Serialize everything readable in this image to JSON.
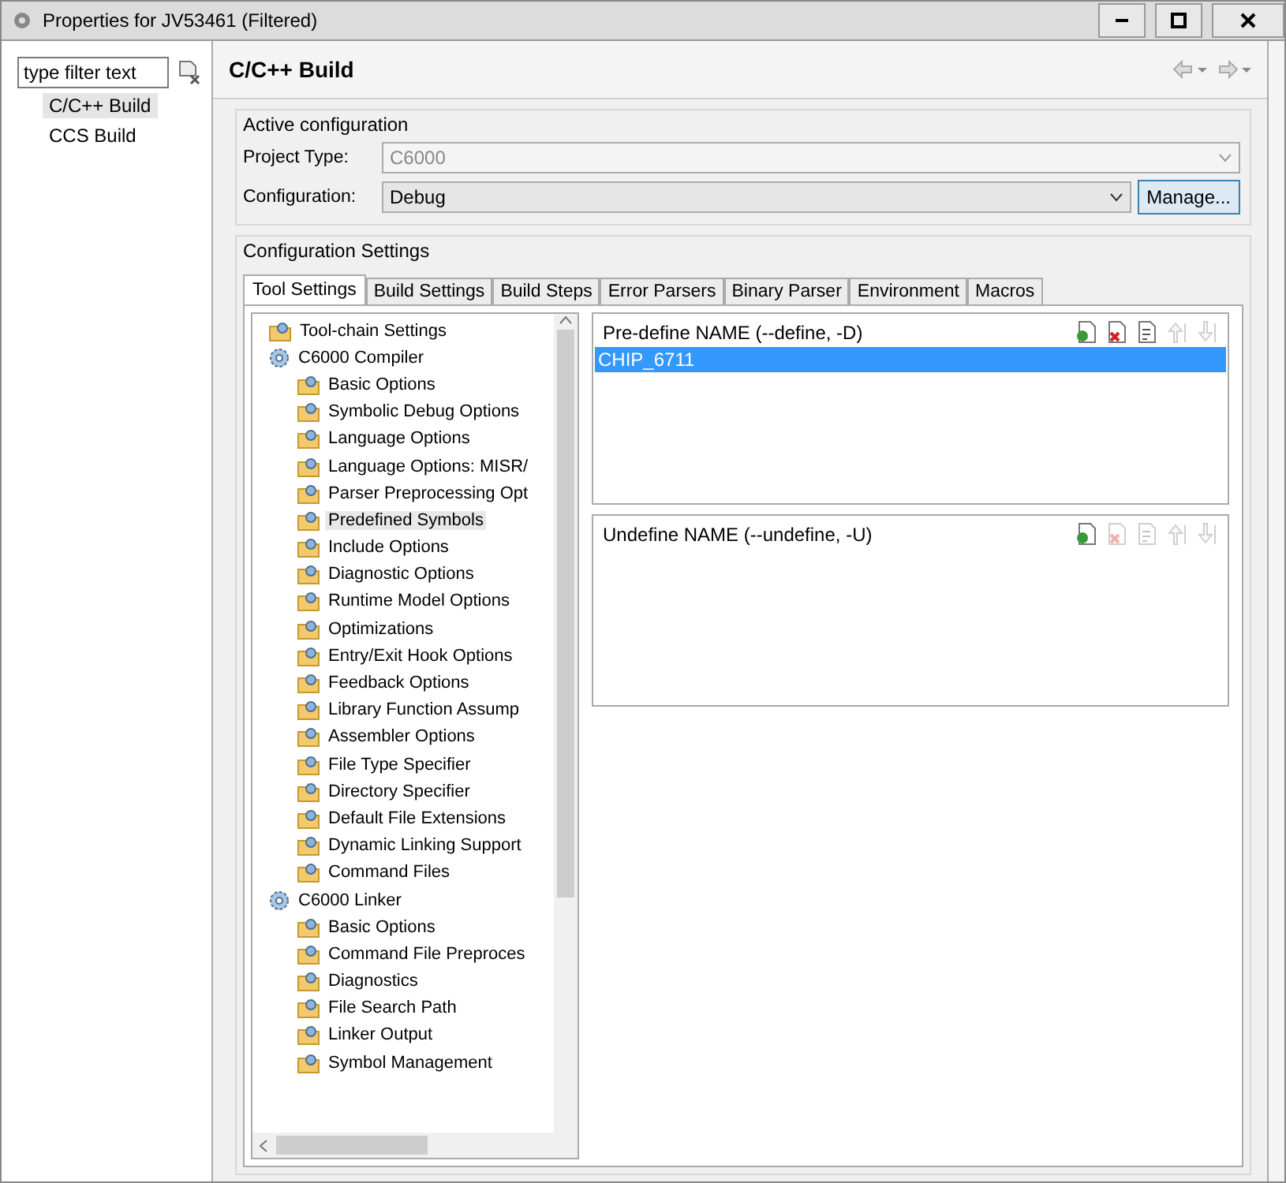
{
  "window": {
    "title": "Properties for JV53461 (Filtered)"
  },
  "filter": {
    "placeholder": "type filter text"
  },
  "nav": [
    {
      "label": "C/C++ Build",
      "selected": true
    },
    {
      "label": "CCS Build",
      "selected": false
    }
  ],
  "page_title": "C/C++ Build",
  "active_configuration": {
    "title": "Active configuration",
    "project_type_label": "Project Type:",
    "project_type": "C6000",
    "project_type_disabled": true,
    "configuration_label": "Configuration:",
    "configuration": "Debug",
    "manage_button": "Manage..."
  },
  "configuration_settings": {
    "title": "Configuration Settings"
  },
  "tabs": [
    {
      "label": "Tool Settings",
      "selected": true
    },
    {
      "label": "Build Settings",
      "selected": false
    },
    {
      "label": "Build Steps",
      "selected": false
    },
    {
      "label": "Error Parsers",
      "selected": false
    },
    {
      "label": "Binary Parser",
      "selected": false
    },
    {
      "label": "Environment",
      "selected": false
    },
    {
      "label": "Macros",
      "selected": false
    }
  ],
  "tree": [
    {
      "label": "Tool-chain Settings",
      "kind": "page",
      "selected": false
    },
    {
      "label": "C6000 Compiler",
      "kind": "tool",
      "selected": false,
      "children": [
        {
          "label": "Basic Options",
          "kind": "page",
          "selected": false
        },
        {
          "label": "Symbolic Debug Options",
          "kind": "page",
          "selected": false
        },
        {
          "label": "Language Options",
          "kind": "page",
          "selected": false
        },
        {
          "label": "Language Options: MISR/",
          "kind": "page",
          "selected": false
        },
        {
          "label": "Parser Preprocessing Opt",
          "kind": "page",
          "selected": false
        },
        {
          "label": "Predefined Symbols",
          "kind": "page",
          "selected": true
        },
        {
          "label": "Include Options",
          "kind": "page",
          "selected": false
        },
        {
          "label": "Diagnostic Options",
          "kind": "page",
          "selected": false
        },
        {
          "label": "Runtime Model Options",
          "kind": "page",
          "selected": false
        },
        {
          "label": "Optimizations",
          "kind": "page",
          "selected": false
        },
        {
          "label": "Entry/Exit Hook Options",
          "kind": "page",
          "selected": false
        },
        {
          "label": "Feedback Options",
          "kind": "page",
          "selected": false
        },
        {
          "label": "Library Function Assump",
          "kind": "page",
          "selected": false
        },
        {
          "label": "Assembler Options",
          "kind": "page",
          "selected": false
        },
        {
          "label": "File Type Specifier",
          "kind": "page",
          "selected": false
        },
        {
          "label": "Directory Specifier",
          "kind": "page",
          "selected": false
        },
        {
          "label": "Default File Extensions",
          "kind": "page",
          "selected": false
        },
        {
          "label": "Dynamic Linking Support",
          "kind": "page",
          "selected": false
        },
        {
          "label": "Command Files",
          "kind": "page",
          "selected": false
        }
      ]
    },
    {
      "label": "C6000 Linker",
      "kind": "tool",
      "selected": false,
      "children": [
        {
          "label": "Basic Options",
          "kind": "page",
          "selected": false
        },
        {
          "label": "Command File Preproces",
          "kind": "page",
          "selected": false
        },
        {
          "label": "Diagnostics",
          "kind": "page",
          "selected": false
        },
        {
          "label": "File Search Path",
          "kind": "page",
          "selected": false
        },
        {
          "label": "Linker Output",
          "kind": "page",
          "selected": false
        },
        {
          "label": "Symbol Management",
          "kind": "page",
          "selected": false
        }
      ]
    }
  ],
  "lists": [
    {
      "title": "Pre-define NAME (--define, -D)",
      "items": [
        {
          "label": "CHIP_6711",
          "selected": true
        }
      ],
      "tools": [
        {
          "kind": "add",
          "disabled": false
        },
        {
          "kind": "delete",
          "disabled": false
        },
        {
          "kind": "edit",
          "disabled": false
        },
        {
          "kind": "up",
          "disabled": true
        },
        {
          "kind": "down",
          "disabled": true
        }
      ]
    },
    {
      "title": "Undefine NAME (--undefine, -U)",
      "tools": [
        {
          "kind": "add",
          "disabled": false
        },
        {
          "kind": "delete",
          "disabled": true
        },
        {
          "kind": "edit",
          "disabled": true
        },
        {
          "kind": "up",
          "disabled": true
        },
        {
          "kind": "down",
          "disabled": true
        }
      ]
    }
  ]
}
